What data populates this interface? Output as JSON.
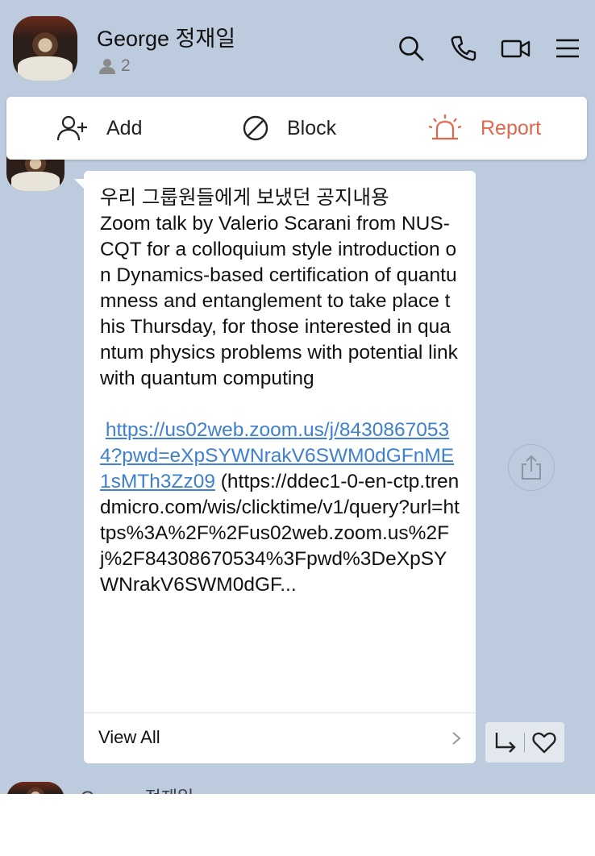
{
  "header": {
    "title": "George 정재일",
    "member_count": "2",
    "icons": [
      "search-icon",
      "phone-icon",
      "video-icon",
      "menu-icon"
    ]
  },
  "action_bar": {
    "add_label": "Add",
    "block_label": "Block",
    "report_label": "Report",
    "report_color": "#e0674b"
  },
  "message": {
    "text_intro": "우리 그룹원들에게 보냈던 공지내용\nZoom talk by Valerio Scarani from NUS-CQT for a colloquium style introduction on Dynamics-based certification of quantumness and entanglement to take place this Thursday, for those interested in quantum physics problems with potential link with quantum computing\n\n ",
    "link": "https://us02web.zoom.us/j/84308670534?pwd=eXpSYWNrakV6SWM0dGFnME1sMTh3Zz09",
    "text_after": " (https://ddec1-0-en-ctp.trendmicro.com/wis/clicktime/v1/query?url=https%3A%2F%2Fus02web.zoom.us%2Fj%2F84308670534%3Fpwd%3DeXpSYWNrakV6SWM0dGF...",
    "view_all_label": "View All"
  },
  "next_message": {
    "sender": "George 정재일"
  },
  "colors": {
    "chat_background": "#bccbdd",
    "link": "#3e7fcf"
  }
}
